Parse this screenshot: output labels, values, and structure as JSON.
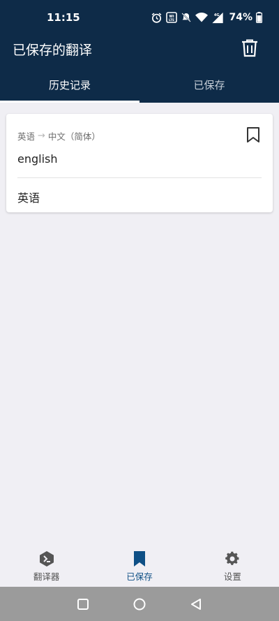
{
  "status_bar": {
    "time": "11:15",
    "battery": "74%",
    "network": "4G"
  },
  "app_bar": {
    "title": "已保存的翻译"
  },
  "tabs": [
    {
      "label": "历史记录",
      "active": true
    },
    {
      "label": "已保存",
      "active": false
    }
  ],
  "history": [
    {
      "source_lang": "英语",
      "target_lang": "中文（简体）",
      "source_text": "english",
      "target_text": "英语"
    }
  ],
  "bottom_nav": [
    {
      "label": "翻译器",
      "icon": "translator-icon",
      "active": false
    },
    {
      "label": "已保存",
      "icon": "bookmark-icon",
      "active": true
    },
    {
      "label": "设置",
      "icon": "gear-icon",
      "active": false
    }
  ],
  "colors": {
    "header": "#0e2b48",
    "accent": "#0e4f85",
    "background": "#f0eff4"
  }
}
